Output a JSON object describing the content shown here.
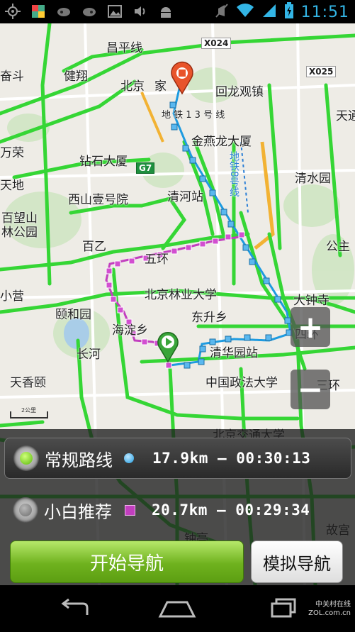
{
  "status": {
    "time": "11:51"
  },
  "map": {
    "labels": {
      "changping": "昌平线",
      "jianxi": "健翔",
      "beijing": "北京",
      "jia": "家",
      "huilongguan": "回龙观镇",
      "line13": "地 铁 1 3 号 线",
      "jinyanlong": "金燕龙大厦",
      "zhuzhou": "钻石大厦",
      "ditie8": "地铁8号线",
      "qingshuiyuan": "清水园",
      "tiantong": "天通",
      "xishanyi": "西山壹号院",
      "qinghezhan": "清河站",
      "baiwangshan": "百望山",
      "linpark": "林公园",
      "baiyi": "百乙",
      "wuhuan": "五环",
      "beilin": "北京林业大学",
      "dongsheng": "东升乡",
      "dazhong": "大钟寺",
      "yiheyuan": "颐和园",
      "haidian": "海淀乡",
      "qinghuayuan": "清华园站",
      "sihuan": "四环",
      "tianxiang": "天香颐",
      "zhongguo": "中国政法大学",
      "beijingjiaotong": "北京交通大学",
      "sanhuan": "三环",
      "zhongting": "钟亭",
      "guchu": "故宫",
      "changguan": "长河",
      "xiaoyuanqu": "小营",
      "fenguan": "奋斗",
      "wanrong": "万荣",
      "tiandian": "天地",
      "gongzhu": "公主"
    },
    "road_codes": {
      "x024": "X024",
      "x025": "X025",
      "g7": "G7"
    },
    "scale": "2公里"
  },
  "routes": [
    {
      "name": "常规路线",
      "stats": "17.9km — 00:30:13",
      "selected": true,
      "marker": "blue-dot"
    },
    {
      "name": "小白推荐",
      "stats": "20.7km — 00:29:34",
      "selected": false,
      "marker": "purple-square"
    }
  ],
  "buttons": {
    "start": "开始导航",
    "simulate": "模拟导航"
  },
  "watermark": {
    "line1": "中关村在线",
    "line2": "ZOL.com.cn"
  },
  "colors": {
    "road": "#35d635",
    "route_blue": "#1e9be0",
    "route_purple": "#c23fbf",
    "status_accent": "#33b5e5"
  }
}
